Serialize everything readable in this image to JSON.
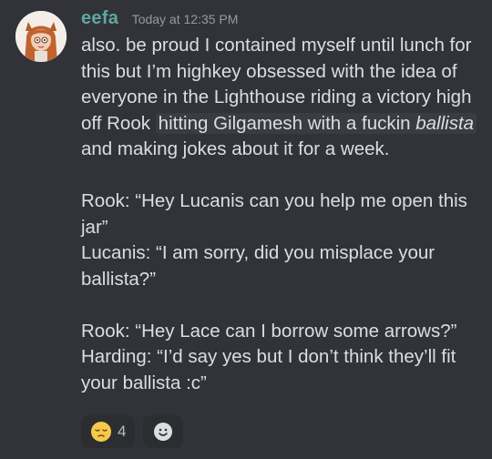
{
  "message": {
    "username": "eefa",
    "timestamp": "Today at 12:35 PM",
    "line1": "also. be proud I contained myself until lunch for this but I’m highkey obsessed with the idea of everyone in the Lighthouse riding a victory high off Rook ",
    "spoiler_text": "hitting Gilgamesh with a fuckin ",
    "spoiler_emph": "ballista",
    "line1_end": " and making jokes about it for a week.",
    "dialogue": [
      "Rook: “Hey Lucanis can you help me open this jar”",
      "Lucanis: “I am sorry, did you misplace your ballista?”",
      "Rook: “Hey Lace can I borrow some arrows?”",
      "Harding: “I’d say yes but I don’t think they’ll fit your ballista :c”"
    ]
  },
  "reactions": [
    {
      "emoji": "pensive-face-icon",
      "count": "4"
    },
    {
      "emoji": "add-reaction-icon"
    }
  ]
}
